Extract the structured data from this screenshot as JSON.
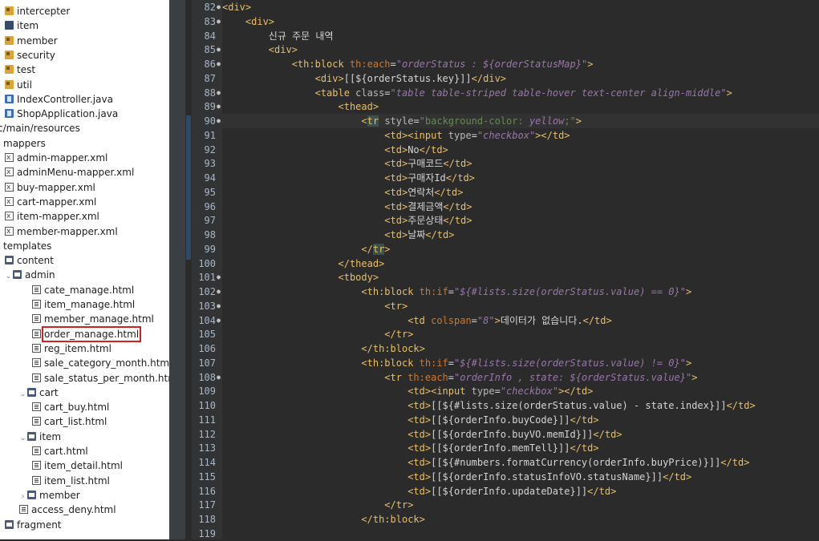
{
  "project_tree": [
    {
      "indent": 6,
      "icon": "package-icon",
      "iconclass": "pkg",
      "label": "intercepter"
    },
    {
      "indent": 6,
      "icon": "package-icon",
      "iconclass": "pkg-blue",
      "label": "item"
    },
    {
      "indent": 6,
      "icon": "package-icon",
      "iconclass": "pkg",
      "label": "member"
    },
    {
      "indent": 6,
      "icon": "package-icon",
      "iconclass": "pkg",
      "label": "security"
    },
    {
      "indent": 6,
      "icon": "package-icon",
      "iconclass": "pkg",
      "label": "test"
    },
    {
      "indent": 6,
      "icon": "package-icon",
      "iconclass": "pkg",
      "label": "util"
    },
    {
      "indent": 6,
      "icon": "java-file-icon",
      "iconclass": "java",
      "label": "IndexController.java"
    },
    {
      "indent": 6,
      "icon": "java-file-icon",
      "iconclass": "java",
      "label": "ShopApplication.java"
    },
    {
      "indent": -3,
      "icon": "",
      "iconclass": "",
      "label": "c/main/resources"
    },
    {
      "indent": -6,
      "icon": "folder-icon",
      "iconclass": "",
      "label": "mappers",
      "twisty": "⌄"
    },
    {
      "indent": 6,
      "icon": "xml-file-icon",
      "iconclass": "xml",
      "label": "admin-mapper.xml"
    },
    {
      "indent": 6,
      "icon": "xml-file-icon",
      "iconclass": "xml",
      "label": "adminMenu-mapper.xml"
    },
    {
      "indent": 6,
      "icon": "xml-file-icon",
      "iconclass": "xml",
      "label": "buy-mapper.xml"
    },
    {
      "indent": 6,
      "icon": "xml-file-icon",
      "iconclass": "xml",
      "label": "cart-mapper.xml"
    },
    {
      "indent": 6,
      "icon": "xml-file-icon",
      "iconclass": "xml",
      "label": "item-mapper.xml"
    },
    {
      "indent": 6,
      "icon": "xml-file-icon",
      "iconclass": "xml",
      "label": "member-mapper.xml"
    },
    {
      "indent": -6,
      "icon": "folder-icon",
      "iconclass": "",
      "label": "templates",
      "twisty": "⌄"
    },
    {
      "indent": 6,
      "icon": "folder-icon",
      "iconclass": "folder",
      "label": "content"
    },
    {
      "indent": 6,
      "icon": "folder-icon",
      "iconclass": "folder",
      "label": "admin",
      "twisty": "⌄",
      "twistx": 9
    },
    {
      "indent": 40,
      "icon": "html-file-icon",
      "iconclass": "html",
      "label": "cate_manage.html"
    },
    {
      "indent": 40,
      "icon": "html-file-icon",
      "iconclass": "html",
      "label": "item_manage.html"
    },
    {
      "indent": 40,
      "icon": "html-file-icon",
      "iconclass": "html",
      "label": "member_manage.html"
    },
    {
      "indent": 40,
      "icon": "html-file-icon",
      "iconclass": "html",
      "label": "order_manage.html",
      "highlight": true
    },
    {
      "indent": 40,
      "icon": "html-file-icon",
      "iconclass": "html",
      "label": "reg_item.html"
    },
    {
      "indent": 40,
      "icon": "html-file-icon",
      "iconclass": "html",
      "label": "sale_category_month.html"
    },
    {
      "indent": 40,
      "icon": "html-file-icon",
      "iconclass": "html",
      "label": "sale_status_per_month.html"
    },
    {
      "indent": 24,
      "icon": "folder-icon",
      "iconclass": "folder",
      "label": "cart",
      "twisty": "⌄",
      "twistx": 9
    },
    {
      "indent": 40,
      "icon": "html-file-icon",
      "iconclass": "html",
      "label": "cart_buy.html"
    },
    {
      "indent": 40,
      "icon": "html-file-icon",
      "iconclass": "html",
      "label": "cart_list.html"
    },
    {
      "indent": 24,
      "icon": "folder-icon",
      "iconclass": "folder",
      "label": "item",
      "twisty": "⌄",
      "twistx": 9
    },
    {
      "indent": 40,
      "icon": "html-file-icon",
      "iconclass": "html",
      "label": "cart.html"
    },
    {
      "indent": 40,
      "icon": "html-file-icon",
      "iconclass": "html",
      "label": "item_detail.html"
    },
    {
      "indent": 40,
      "icon": "html-file-icon",
      "iconclass": "html",
      "label": "item_list.html"
    },
    {
      "indent": 24,
      "icon": "folder-icon",
      "iconclass": "folder",
      "label": "member",
      "twisty": "›",
      "twistx": 9
    },
    {
      "indent": 24,
      "icon": "html-file-icon",
      "iconclass": "html",
      "label": "access_deny.html"
    },
    {
      "indent": 6,
      "icon": "folder-icon",
      "iconclass": "folder",
      "label": "fragment"
    }
  ],
  "code_lines": [
    {
      "n": "82",
      "fold": true,
      "segs": [
        [
          "tg",
          "<div>"
        ]
      ]
    },
    {
      "n": "83",
      "fold": true,
      "segs": [
        [
          "sp",
          "    "
        ],
        [
          "tg",
          "<div>"
        ]
      ]
    },
    {
      "n": "84",
      "segs": [
        [
          "sp",
          "        "
        ],
        [
          "tx",
          "신규 주문 내역"
        ]
      ]
    },
    {
      "n": "85",
      "fold": true,
      "segs": [
        [
          "sp",
          "        "
        ],
        [
          "tg",
          "<div>"
        ]
      ]
    },
    {
      "n": "86",
      "fold": true,
      "segs": [
        [
          "sp",
          "            "
        ],
        [
          "tg",
          "<th:block "
        ],
        [
          "th",
          "th:each"
        ],
        [
          "tx",
          "="
        ],
        [
          "ex",
          "\"orderStatus : ${orderStatusMap}\""
        ],
        [
          "tg",
          ">"
        ]
      ]
    },
    {
      "n": "87",
      "segs": [
        [
          "sp",
          "                "
        ],
        [
          "tg",
          "<div>"
        ],
        [
          "tx",
          "[[${orderStatus.key}]]"
        ],
        [
          "tg",
          "</div>"
        ]
      ]
    },
    {
      "n": "88",
      "fold": true,
      "segs": [
        [
          "sp",
          "                "
        ],
        [
          "tg",
          "<table "
        ],
        [
          "at",
          "class"
        ],
        [
          "tx",
          "="
        ],
        [
          "ex",
          "\"table table-striped table-hover text-center align-middle\""
        ],
        [
          "tg",
          ">"
        ]
      ]
    },
    {
      "n": "89",
      "fold": true,
      "segs": [
        [
          "sp",
          "                    "
        ],
        [
          "tg",
          "<thead>"
        ]
      ]
    },
    {
      "n": "90",
      "fold": true,
      "cur": true,
      "segs": [
        [
          "sp",
          "                        "
        ],
        [
          "tg",
          "<"
        ],
        [
          "pair",
          "tr"
        ],
        [
          "tg",
          " "
        ],
        [
          "at",
          "style"
        ],
        [
          "tx",
          "="
        ],
        [
          "av",
          "\"background-color: "
        ],
        [
          "ex",
          "yellow"
        ],
        [
          "av",
          ";\""
        ],
        [
          "tg",
          ">"
        ]
      ]
    },
    {
      "n": "91",
      "segs": [
        [
          "sp",
          "                            "
        ],
        [
          "tg",
          "<td>"
        ],
        [
          "tg",
          "<input "
        ],
        [
          "at",
          "type"
        ],
        [
          "tx",
          "="
        ],
        [
          "ex",
          "\"checkbox\""
        ],
        [
          "tg",
          "></td>"
        ]
      ]
    },
    {
      "n": "92",
      "segs": [
        [
          "sp",
          "                            "
        ],
        [
          "tg",
          "<td>"
        ],
        [
          "tx",
          "No"
        ],
        [
          "tg",
          "</td>"
        ]
      ]
    },
    {
      "n": "93",
      "segs": [
        [
          "sp",
          "                            "
        ],
        [
          "tg",
          "<td>"
        ],
        [
          "tx",
          "구매코드"
        ],
        [
          "tg",
          "</td>"
        ]
      ]
    },
    {
      "n": "94",
      "segs": [
        [
          "sp",
          "                            "
        ],
        [
          "tg",
          "<td>"
        ],
        [
          "tx",
          "구매자Id"
        ],
        [
          "tg",
          "</td>"
        ]
      ]
    },
    {
      "n": "95",
      "segs": [
        [
          "sp",
          "                            "
        ],
        [
          "tg",
          "<td>"
        ],
        [
          "tx",
          "연락처"
        ],
        [
          "tg",
          "</td>"
        ]
      ]
    },
    {
      "n": "96",
      "segs": [
        [
          "sp",
          "                            "
        ],
        [
          "tg",
          "<td>"
        ],
        [
          "tx",
          "결제금액"
        ],
        [
          "tg",
          "</td>"
        ]
      ]
    },
    {
      "n": "97",
      "segs": [
        [
          "sp",
          "                            "
        ],
        [
          "tg",
          "<td>"
        ],
        [
          "tx",
          "주문상태"
        ],
        [
          "tg",
          "</td>"
        ]
      ]
    },
    {
      "n": "98",
      "segs": [
        [
          "sp",
          "                            "
        ],
        [
          "tg",
          "<td>"
        ],
        [
          "tx",
          "날짜"
        ],
        [
          "tg",
          "</td>"
        ]
      ]
    },
    {
      "n": "99",
      "segs": [
        [
          "sp",
          "                        "
        ],
        [
          "tg",
          "</"
        ],
        [
          "pair",
          "tr"
        ],
        [
          "tg",
          ">"
        ]
      ]
    },
    {
      "n": "100",
      "segs": [
        [
          "sp",
          "                    "
        ],
        [
          "tg",
          "</thead>"
        ]
      ]
    },
    {
      "n": "101",
      "fold": true,
      "segs": [
        [
          "sp",
          "                    "
        ],
        [
          "tg",
          "<tbody>"
        ]
      ]
    },
    {
      "n": "102",
      "fold": true,
      "segs": [
        [
          "sp",
          "                        "
        ],
        [
          "tg",
          "<th:block "
        ],
        [
          "th",
          "th:if"
        ],
        [
          "tx",
          "="
        ],
        [
          "ex",
          "\"${#lists.size(orderStatus.value) == 0}\""
        ],
        [
          "tg",
          ">"
        ]
      ]
    },
    {
      "n": "103",
      "fold": true,
      "segs": [
        [
          "sp",
          "                            "
        ],
        [
          "tg",
          "<tr>"
        ]
      ]
    },
    {
      "n": "104",
      "fold": true,
      "segs": [
        [
          "sp",
          "                                "
        ],
        [
          "tg",
          "<td "
        ],
        [
          "th",
          "colspan"
        ],
        [
          "tx",
          "="
        ],
        [
          "ex",
          "\"8\""
        ],
        [
          "tg",
          ">"
        ],
        [
          "tx",
          "데이터가 없습니다."
        ],
        [
          "tg",
          "</td>"
        ]
      ]
    },
    {
      "n": "105",
      "segs": [
        [
          "sp",
          "                            "
        ],
        [
          "tg",
          "</tr>"
        ]
      ]
    },
    {
      "n": "106",
      "segs": [
        [
          "sp",
          "                        "
        ],
        [
          "tg",
          "</th:block>"
        ]
      ]
    },
    {
      "n": "107",
      "segs": [
        [
          "sp",
          "                        "
        ],
        [
          "tg",
          "<th:block "
        ],
        [
          "th",
          "th:if"
        ],
        [
          "tx",
          "="
        ],
        [
          "ex",
          "\"${#lists.size(orderStatus.value) != 0}\""
        ],
        [
          "tg",
          ">"
        ]
      ]
    },
    {
      "n": "108",
      "fold": true,
      "segs": [
        [
          "sp",
          "                            "
        ],
        [
          "tg",
          "<tr "
        ],
        [
          "th",
          "th:each"
        ],
        [
          "tx",
          "="
        ],
        [
          "ex",
          "\"orderInfo , state: ${orderStatus.value}\""
        ],
        [
          "tg",
          ">"
        ]
      ]
    },
    {
      "n": "109",
      "segs": [
        [
          "sp",
          "                                "
        ],
        [
          "tg",
          "<td>"
        ],
        [
          "tg",
          "<input "
        ],
        [
          "at",
          "type"
        ],
        [
          "tx",
          "="
        ],
        [
          "ex",
          "\"checkbox\""
        ],
        [
          "tg",
          "></td>"
        ]
      ]
    },
    {
      "n": "110",
      "segs": [
        [
          "sp",
          "                                "
        ],
        [
          "tg",
          "<td>"
        ],
        [
          "tx",
          "[[${#lists.size(orderStatus.value) - state.index}]]"
        ],
        [
          "tg",
          "</td>"
        ]
      ]
    },
    {
      "n": "111",
      "segs": [
        [
          "sp",
          "                                "
        ],
        [
          "tg",
          "<td>"
        ],
        [
          "tx",
          "[[${orderInfo.buyCode}]]"
        ],
        [
          "tg",
          "</td>"
        ]
      ]
    },
    {
      "n": "112",
      "segs": [
        [
          "sp",
          "                                "
        ],
        [
          "tg",
          "<td>"
        ],
        [
          "tx",
          "[[${orderInfo.buyVO.memId}]]"
        ],
        [
          "tg",
          "</td>"
        ]
      ]
    },
    {
      "n": "113",
      "segs": [
        [
          "sp",
          "                                "
        ],
        [
          "tg",
          "<td>"
        ],
        [
          "tx",
          "[[${orderInfo.memTell}]]"
        ],
        [
          "tg",
          "</td>"
        ]
      ]
    },
    {
      "n": "114",
      "segs": [
        [
          "sp",
          "                                "
        ],
        [
          "tg",
          "<td>"
        ],
        [
          "tx",
          "[[${#numbers.formatCurrency(orderInfo.buyPrice)}]]"
        ],
        [
          "tg",
          "</td>"
        ]
      ]
    },
    {
      "n": "115",
      "segs": [
        [
          "sp",
          "                                "
        ],
        [
          "tg",
          "<td>"
        ],
        [
          "tx",
          "[[${orderInfo.statusInfoVO.statusName}]]"
        ],
        [
          "tg",
          "</td>"
        ]
      ]
    },
    {
      "n": "116",
      "segs": [
        [
          "sp",
          "                                "
        ],
        [
          "tg",
          "<td>"
        ],
        [
          "tx",
          "[[${orderInfo.updateDate}]]"
        ],
        [
          "tg",
          "</td>"
        ]
      ]
    },
    {
      "n": "117",
      "segs": [
        [
          "sp",
          "                            "
        ],
        [
          "tg",
          "</tr>"
        ]
      ]
    },
    {
      "n": "118",
      "segs": [
        [
          "sp",
          "                        "
        ],
        [
          "tg",
          "</th:block>"
        ]
      ]
    },
    {
      "n": "119",
      "segs": [
        [
          "sp",
          ""
        ]
      ]
    }
  ]
}
